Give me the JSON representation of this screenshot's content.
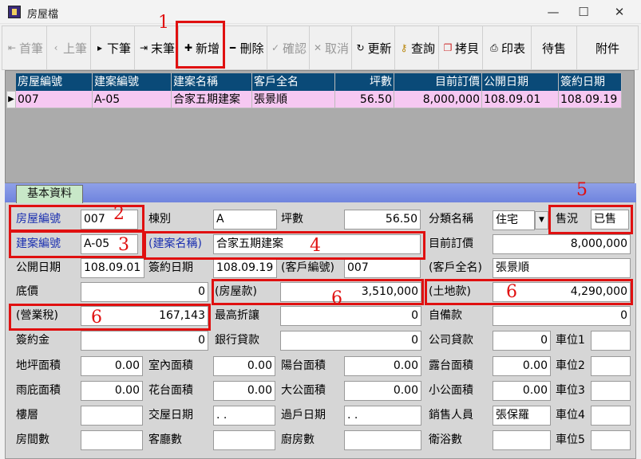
{
  "window": {
    "title": "房屋檔",
    "min": "—",
    "max": "☐",
    "close": "✕"
  },
  "toolbar": {
    "first": "首筆",
    "prev": "上筆",
    "next": "下筆",
    "last": "末筆",
    "add": "新增",
    "delete": "刪除",
    "confirm": "確認",
    "cancel": "取消",
    "refresh": "更新",
    "query": "查詢",
    "copy": "拷貝",
    "print": "印表",
    "pending": "待售",
    "attach": "附件"
  },
  "grid": {
    "headers": [
      "房屋編號",
      "建案編號",
      "建案名稱",
      "客戶全名",
      "坪數",
      "目前訂價",
      "公開日期",
      "簽約日期"
    ],
    "rows": [
      [
        "007",
        "A-05",
        "合家五期建案",
        "張景順",
        "56.50",
        "8,000,000",
        "108.09.01",
        "108.09.19"
      ]
    ]
  },
  "tabs": {
    "basic": "基本資料"
  },
  "form": {
    "house_no_label": "房屋編號",
    "house_no": "007",
    "building_label": "棟別",
    "building": "A",
    "ping_label": "坪數",
    "ping": "56.50",
    "category_label": "分類名稱",
    "category": "住宅",
    "sale_status_label": "售況",
    "sale_status": "已售",
    "project_no_label": "建案編號",
    "project_no": "A-05",
    "project_name_label": "(建案名稱)",
    "project_name": "合家五期建案",
    "current_price_label": "目前訂價",
    "current_price": "8,000,000",
    "publish_date_label": "公開日期",
    "publish_date": "108.09.01",
    "sign_date_label": "簽約日期",
    "sign_date": "108.09.19",
    "customer_no_label": "(客戶編號)",
    "customer_no": "007",
    "customer_name_label": "(客戶全名)",
    "customer_name": "張景順",
    "base_price_label": "底價",
    "base_price": "0",
    "house_payment_label": "(房屋款)",
    "house_payment": "3,510,000",
    "land_payment_label": "(土地款)",
    "land_payment": "4,290,000",
    "business_tax_label": "(營業稅)",
    "business_tax": "167,143",
    "max_discount_label": "最高折讓",
    "max_discount": "0",
    "self_fund_label": "自備款",
    "self_fund": "0",
    "deposit_label": "簽約金",
    "deposit": "0",
    "bank_loan_label": "銀行貸款",
    "bank_loan": "0",
    "company_loan_label": "公司貸款",
    "company_loan": "0",
    "parking1_label": "車位1",
    "land_area_label": "地坪面積",
    "land_area": "0.00",
    "indoor_area_label": "室內面積",
    "indoor_area": "0.00",
    "balcony_area_label": "陽台面積",
    "balcony_area": "0.00",
    "terrace_area_label": "露台面積",
    "terrace_area": "0.00",
    "parking2_label": "車位2",
    "eave_area_label": "雨庇面積",
    "eave_area": "0.00",
    "flower_area_label": "花台面積",
    "flower_area": "0.00",
    "public_large_label": "大公面積",
    "public_large": "0.00",
    "public_small_label": "小公面積",
    "public_small": "0.00",
    "parking3_label": "車位3",
    "floor_label": "樓層",
    "handover_date_label": "交屋日期",
    "handover_date": " . .",
    "transfer_date_label": "過戶日期",
    "transfer_date": " . .",
    "sales_person_label": "銷售人員",
    "sales_person": "張保羅",
    "parking4_label": "車位4",
    "rooms_label": "房間數",
    "living_rooms_label": "客廳數",
    "kitchens_label": "廚房數",
    "bathrooms_label": "衛浴數",
    "parking5_label": "車位5"
  },
  "annotations": [
    "1",
    "2",
    "3",
    "4",
    "5",
    "6",
    "6",
    "6"
  ],
  "colors": {
    "grid_header": "#0a4a78",
    "grid_row": "#f6c8f2",
    "tab_strip": "#7a8fe4",
    "label_blue": "#1a2fb0",
    "markup_red": "#e01010"
  }
}
